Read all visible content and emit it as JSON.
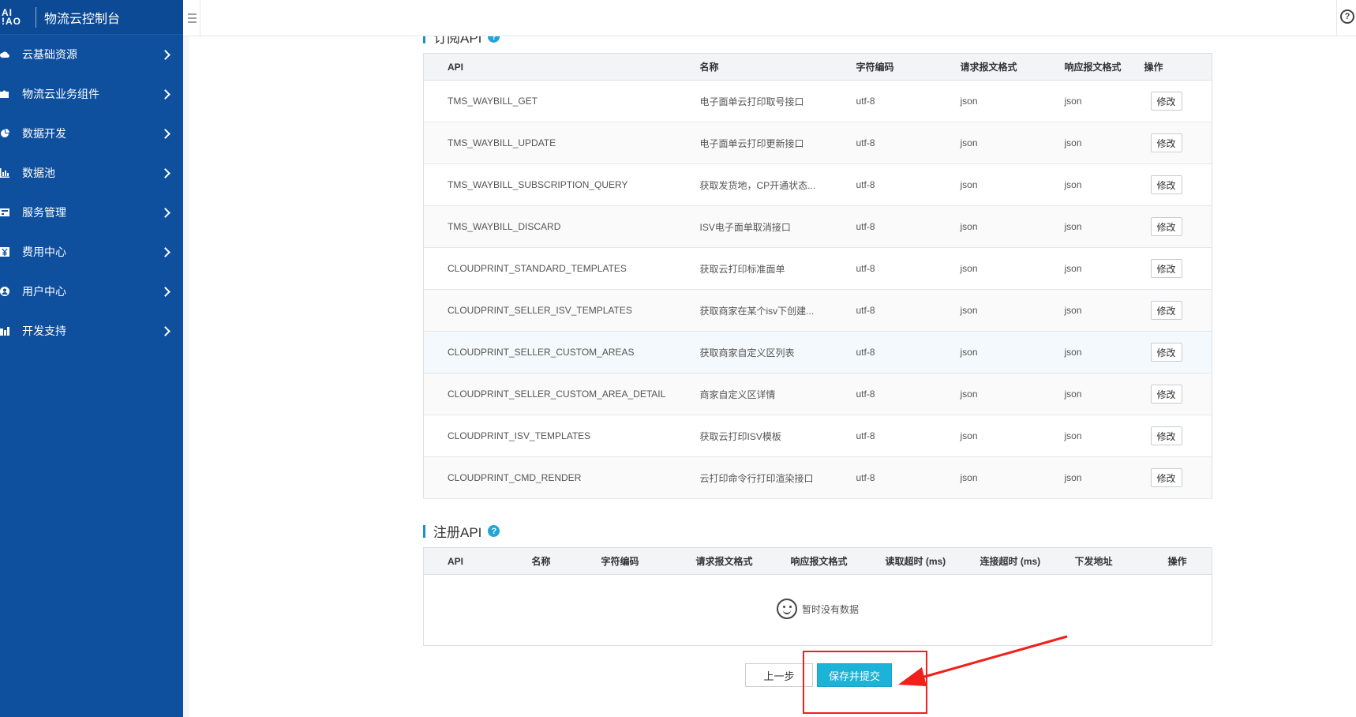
{
  "sidebar": {
    "logo_line1": "AI",
    "logo_line2": "!AO",
    "title": "物流云控制台",
    "items": [
      {
        "label": "云基础资源",
        "icon": "cloud-icon"
      },
      {
        "label": "物流云业务组件",
        "icon": "puzzle-icon"
      },
      {
        "label": "数据开发",
        "icon": "pie-chart-icon"
      },
      {
        "label": "数据池",
        "icon": "bar-chart-icon"
      },
      {
        "label": "服务管理",
        "icon": "server-icon"
      },
      {
        "label": "费用中心",
        "icon": "yen-icon"
      },
      {
        "label": "用户中心",
        "icon": "user-icon"
      },
      {
        "label": "开发支持",
        "icon": "dev-icon"
      }
    ]
  },
  "topbar": {
    "help_icon": "help-icon",
    "help_glyph": "?"
  },
  "subscribe": {
    "title": "订阅API",
    "help_glyph": "?",
    "columns": [
      "API",
      "名称",
      "字符编码",
      "请求报文格式",
      "响应报文格式",
      "操作"
    ],
    "edit_label": "修改",
    "rows": [
      {
        "api": "TMS_WAYBILL_GET",
        "name": "电子面单云打印取号接口",
        "encoding": "utf-8",
        "req": "json",
        "resp": "json"
      },
      {
        "api": "TMS_WAYBILL_UPDATE",
        "name": "电子面单云打印更新接口",
        "encoding": "utf-8",
        "req": "json",
        "resp": "json"
      },
      {
        "api": "TMS_WAYBILL_SUBSCRIPTION_QUERY",
        "name": "获取发货地，CP开通状态...",
        "encoding": "utf-8",
        "req": "json",
        "resp": "json"
      },
      {
        "api": "TMS_WAYBILL_DISCARD",
        "name": "ISV电子面单取消接口",
        "encoding": "utf-8",
        "req": "json",
        "resp": "json"
      },
      {
        "api": "CLOUDPRINT_STANDARD_TEMPLATES",
        "name": "获取云打印标准面单",
        "encoding": "utf-8",
        "req": "json",
        "resp": "json"
      },
      {
        "api": "CLOUDPRINT_SELLER_ISV_TEMPLATES",
        "name": "获取商家在某个isv下创建...",
        "encoding": "utf-8",
        "req": "json",
        "resp": "json"
      },
      {
        "api": "CLOUDPRINT_SELLER_CUSTOM_AREAS",
        "name": "获取商家自定义区列表",
        "encoding": "utf-8",
        "req": "json",
        "resp": "json"
      },
      {
        "api": "CLOUDPRINT_SELLER_CUSTOM_AREA_DETAIL",
        "name": "商家自定义区详情",
        "encoding": "utf-8",
        "req": "json",
        "resp": "json"
      },
      {
        "api": "CLOUDPRINT_ISV_TEMPLATES",
        "name": "获取云打印ISV模板",
        "encoding": "utf-8",
        "req": "json",
        "resp": "json"
      },
      {
        "api": "CLOUDPRINT_CMD_RENDER",
        "name": "云打印命令行打印渲染接口",
        "encoding": "utf-8",
        "req": "json",
        "resp": "json"
      }
    ]
  },
  "register": {
    "title": "注册API",
    "help_glyph": "?",
    "columns": [
      "API",
      "名称",
      "字符编码",
      "请求报文格式",
      "响应报文格式",
      "读取超时 (ms)",
      "连接超时 (ms)",
      "下发地址",
      "操作"
    ],
    "empty_text": "暂时没有数据",
    "empty_icon": "smiley-icon"
  },
  "footer": {
    "prev_label": "上一步",
    "save_label": "保存并提交"
  },
  "annotation": {
    "color": "#f0201a"
  }
}
